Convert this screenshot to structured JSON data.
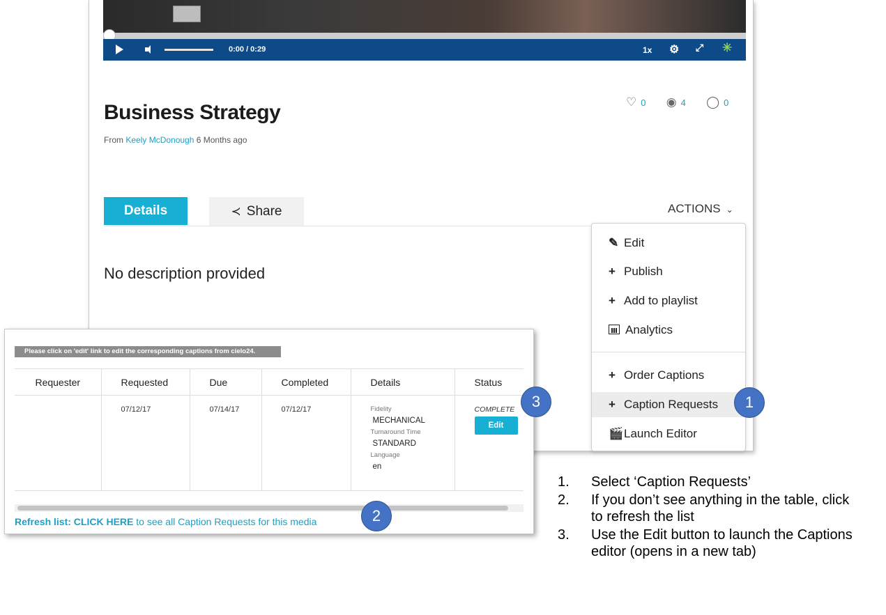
{
  "player": {
    "time_display": "0:00  / 0:29",
    "speed": "1x",
    "icons": [
      "play-icon",
      "volume-icon",
      "gear-icon",
      "fullscreen-icon",
      "kaltura-brand-icon"
    ]
  },
  "media": {
    "title": "Business Strategy",
    "byline_prefix": "From ",
    "author": "Keely McDonough",
    "age": " 6 Months ago",
    "likes": "0",
    "views": "4",
    "comments": "0",
    "description": "No description provided"
  },
  "tabs": [
    {
      "label": "Details"
    },
    {
      "label": "Share"
    }
  ],
  "actions": {
    "label": "ACTIONS",
    "items": [
      {
        "label": "Edit",
        "icon": "pencil-icon"
      },
      {
        "label": "Publish",
        "icon": "plus-icon"
      },
      {
        "label": "Add to playlist",
        "icon": "plus-icon"
      },
      {
        "label": "Analytics",
        "icon": "analytics-icon"
      },
      {
        "label": "Order Captions",
        "icon": "plus-icon"
      },
      {
        "label": "Caption Requests",
        "icon": "plus-icon"
      },
      {
        "label": "Launch Editor",
        "icon": "clapperboard-icon"
      }
    ]
  },
  "caption_requests": {
    "hint": "Please click on 'edit' link to edit the corresponding captions from cielo24.",
    "columns": [
      "Requester",
      "Requested",
      "Due",
      "Completed",
      "Details",
      "Status"
    ],
    "row": {
      "requester": "",
      "requested": "07/12/17",
      "due": "07/14/17",
      "completed": "07/12/17",
      "fidelity_label": "Fidelity",
      "fidelity": "MECHANICAL",
      "turnaround_label": "Turnaround Time",
      "turnaround": "STANDARD",
      "language_label": "Language",
      "language": "en",
      "status": "COMPLETE",
      "edit_label": "Edit"
    },
    "refresh_strong": "Refresh list: CLICK HERE",
    "refresh_rest": " to see all Caption Requests for this media"
  },
  "callouts": [
    "1",
    "2",
    "3"
  ],
  "instructions": [
    {
      "num": "1.",
      "text": "Select ‘Caption Requests’"
    },
    {
      "num": "2.",
      "text": "If you don’t see anything in the table, click to refresh the list"
    },
    {
      "num": "3.",
      "text": "Use the Edit button to launch the Captions editor (opens in a new tab)"
    }
  ],
  "colors": {
    "accent": "#17b0d4",
    "player_bar": "#0e4a88",
    "callout": "#4472c4"
  }
}
